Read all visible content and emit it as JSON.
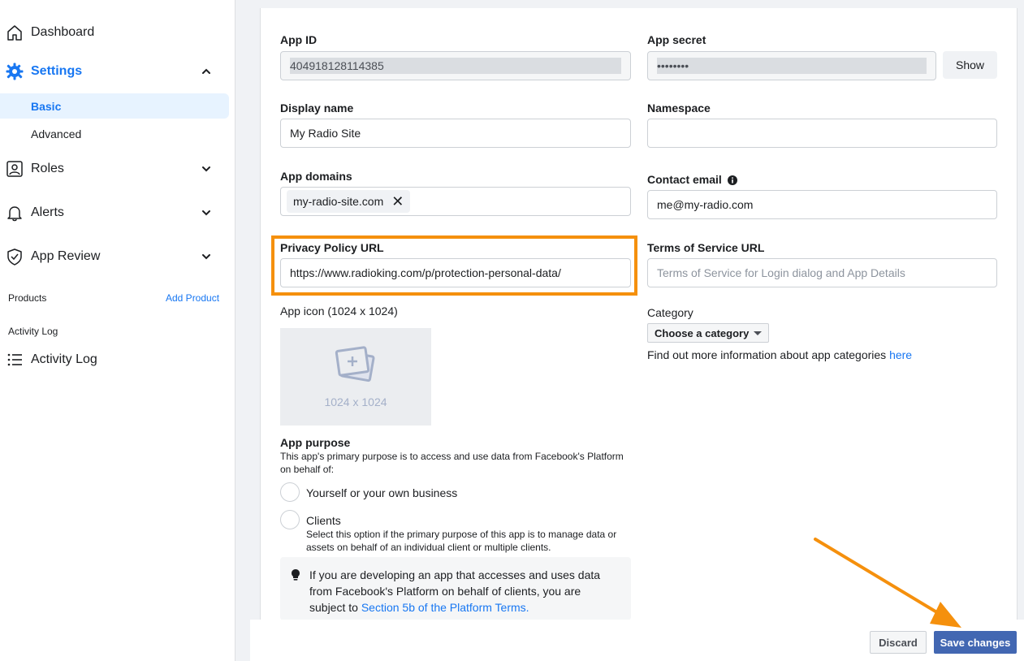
{
  "sidebar": {
    "dashboard": "Dashboard",
    "settings": "Settings",
    "basic": "Basic",
    "advanced": "Advanced",
    "roles": "Roles",
    "alerts": "Alerts",
    "app_review": "App Review",
    "products_title": "Products",
    "add_product": "Add Product",
    "activity_log_title": "Activity Log",
    "activity_log": "Activity Log"
  },
  "form": {
    "app_id_label": "App ID",
    "app_id_value": "404918128114385",
    "app_secret_label": "App secret",
    "app_secret_value": "••••••••",
    "show_button": "Show",
    "display_name_label": "Display name",
    "display_name_value": "My Radio Site",
    "namespace_label": "Namespace",
    "namespace_value": "",
    "app_domains_label": "App domains",
    "app_domain_chip": "my-radio-site.com",
    "contact_email_label": "Contact email",
    "contact_email_value": "me@my-radio.com",
    "privacy_label": "Privacy Policy URL",
    "privacy_value": "https://www.radioking.com/p/protection-personal-data/",
    "tos_label": "Terms of Service URL",
    "tos_placeholder": "Terms of Service for Login dialog and App Details",
    "app_icon_label": "App icon (1024 x 1024)",
    "app_icon_size": "1024 x 1024",
    "category_label": "Category",
    "category_select": "Choose a category",
    "category_info": "Find out more information about app categories",
    "category_link": "here",
    "purpose_label": "App purpose",
    "purpose_desc": "This app's primary purpose is to access and use data from Facebook's Platform on behalf of:",
    "option_yourself": "Yourself or your own business",
    "option_clients": "Clients",
    "option_clients_desc": "Select this option if the primary purpose of this app is to manage data or assets on behalf of an individual client or multiple clients.",
    "notice_text": "If you are developing an app that accesses and uses data from Facebook's Platform on behalf of clients, you are subject to",
    "notice_link": "Section 5b of the Platform Terms."
  },
  "footer": {
    "discard": "Discard",
    "save": "Save changes"
  },
  "colors": {
    "accent": "#1877f2",
    "highlight": "#f5900d",
    "save_button": "#4267b2"
  }
}
